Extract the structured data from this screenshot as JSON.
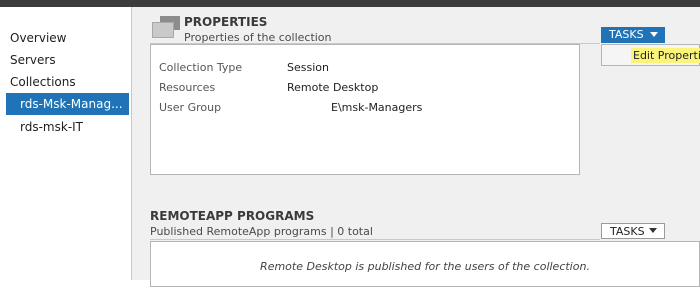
{
  "sidebar": {
    "items": [
      {
        "label": "Overview"
      },
      {
        "label": "Servers"
      },
      {
        "label": "Collections"
      },
      {
        "label": "rds-Msk-Manag..."
      },
      {
        "label": "rds-msk-IT"
      }
    ]
  },
  "properties": {
    "title": "PROPERTIES",
    "subtitle": "Properties of the collection",
    "tasks_label": "TASKS",
    "tasks_menu": {
      "items": [
        {
          "label": "Edit Properties"
        }
      ]
    },
    "rows": [
      {
        "label": "Collection Type",
        "value": "Session"
      },
      {
        "label": "Resources",
        "value": "Remote Desktop"
      },
      {
        "label": "User Group",
        "value": "E\\msk-Managers"
      }
    ]
  },
  "remoteapp": {
    "title": "REMOTEAPP PROGRAMS",
    "subtitle": "Published RemoteApp programs | 0 total",
    "tasks_label": "TASKS",
    "message": "Remote Desktop is published for the users of the collection."
  },
  "colors": {
    "accent": "#1f73b6",
    "highlight": "#fbf47a",
    "topbar": "#3c3c3c"
  }
}
